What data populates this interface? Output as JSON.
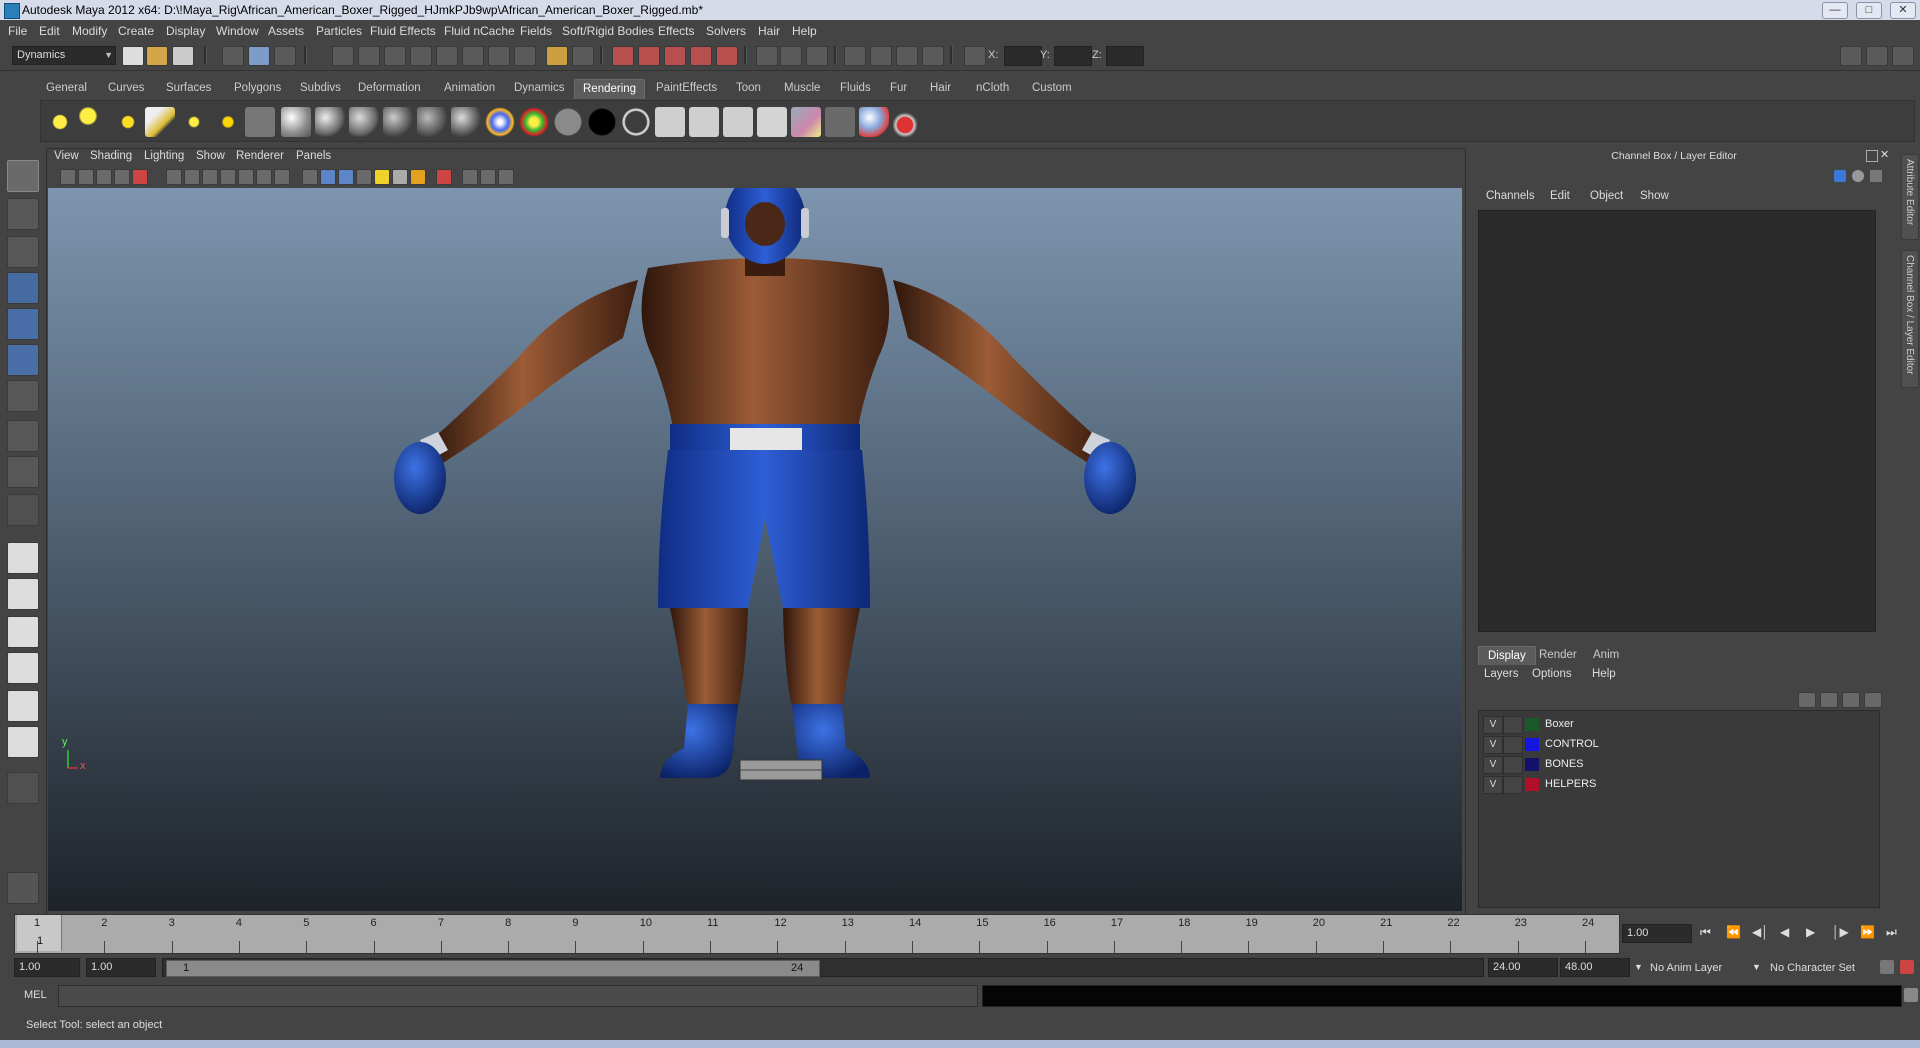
{
  "window": {
    "title": "Autodesk Maya 2012 x64: D:\\!Maya_Rig\\African_American_Boxer_Rigged_HJmkPJb9wp\\African_American_Boxer_Rigged.mb*"
  },
  "menubar": [
    "File",
    "Edit",
    "Modify",
    "Create",
    "Display",
    "Window",
    "Assets",
    "Particles",
    "Fluid Effects",
    "Fluid nCache",
    "Fields",
    "Soft/Rigid Bodies",
    "Effects",
    "Solvers",
    "Hair",
    "Help"
  ],
  "statusline": {
    "menuset": "Dynamics",
    "x_label": "X:",
    "y_label": "Y:",
    "z_label": "Z:"
  },
  "shelf_tabs": [
    "General",
    "Curves",
    "Surfaces",
    "Polygons",
    "Subdivs",
    "Deformation",
    "Animation",
    "Dynamics",
    "Rendering",
    "PaintEffects",
    "Toon",
    "Muscle",
    "Fluids",
    "Fur",
    "Hair",
    "nCloth",
    "Custom"
  ],
  "active_shelf_tab": "Rendering",
  "viewport_menu": [
    "View",
    "Shading",
    "Lighting",
    "Show",
    "Renderer",
    "Panels"
  ],
  "viewport": {
    "axis_x": "x",
    "axis_y": "y",
    "model": "African American boxer character with blue headgear, gloves, shorts and boots"
  },
  "channel_box": {
    "title": "Channel Box / Layer Editor",
    "menu": [
      "Channels",
      "Edit",
      "Object",
      "Show"
    ]
  },
  "side_tabs": [
    "Attribute Editor",
    "Channel Box / Layer Editor"
  ],
  "layer_editor": {
    "tabs": [
      "Display",
      "Render",
      "Anim"
    ],
    "active_tab": "Display",
    "menu": [
      "Layers",
      "Options",
      "Help"
    ],
    "layers": [
      {
        "visible": "V",
        "name": "Boxer",
        "color": "#1a5a2a"
      },
      {
        "visible": "V",
        "name": "CONTROL",
        "color": "#1515e0"
      },
      {
        "visible": "V",
        "name": "BONES",
        "color": "#12126a"
      },
      {
        "visible": "V",
        "name": "HELPERS",
        "color": "#b0102a"
      }
    ]
  },
  "timeline": {
    "ticks": [
      "1",
      "2",
      "3",
      "4",
      "5",
      "6",
      "7",
      "8",
      "9",
      "10",
      "11",
      "12",
      "13",
      "14",
      "15",
      "16",
      "17",
      "18",
      "19",
      "20",
      "21",
      "22",
      "23",
      "24"
    ],
    "current_frame": "1",
    "current_time_field": "1.00"
  },
  "range": {
    "start": "1.00",
    "anim_start": "1.00",
    "range_start": "1",
    "range_end": "24",
    "anim_end": "24.00",
    "end": "48.00",
    "anim_layer": "No Anim Layer",
    "character_set": "No Character Set"
  },
  "command_line": {
    "label": "MEL"
  },
  "help_line": "Select Tool: select an object"
}
